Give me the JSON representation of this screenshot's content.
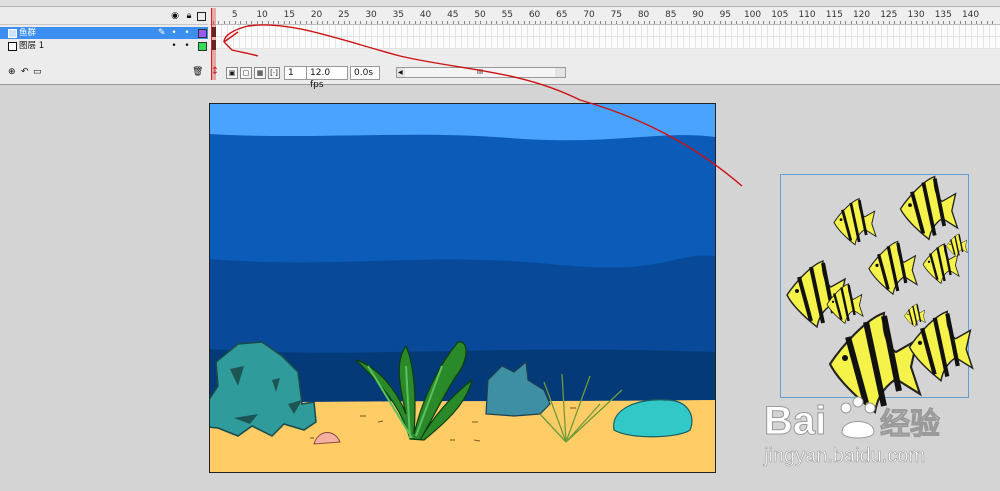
{
  "timeline": {
    "ruler_numbers": [
      "5",
      "10",
      "15",
      "20",
      "25",
      "30",
      "35",
      "40",
      "45",
      "50",
      "55",
      "60",
      "65",
      "70",
      "75",
      "80",
      "85",
      "90",
      "95",
      "100",
      "105",
      "110",
      "115",
      "120",
      "125",
      "130",
      "135",
      "140"
    ],
    "header_icons": [
      "eye-icon",
      "lock-icon",
      "outline-icon"
    ],
    "layers": [
      {
        "name": "鱼群",
        "selected": true,
        "color": "#9b59f0"
      },
      {
        "name": "图层 1",
        "selected": false,
        "color": "#33dd55"
      }
    ],
    "current_frame": "1",
    "frame_rate": "12.0 fps",
    "elapsed_time": "0.0s",
    "scroll_thumb": "III"
  },
  "watermark": {
    "brand_left": "Bai",
    "brand_right": "经验",
    "url": "jingyan.baidu.com"
  },
  "colors": {
    "sky": "#4aa3ff",
    "water_mid": "#0a5cb8",
    "water_deep": "#084a99",
    "water_dark": "#053a78",
    "sand": "#ffcc66",
    "annotation_arrow": "#cc1111"
  }
}
